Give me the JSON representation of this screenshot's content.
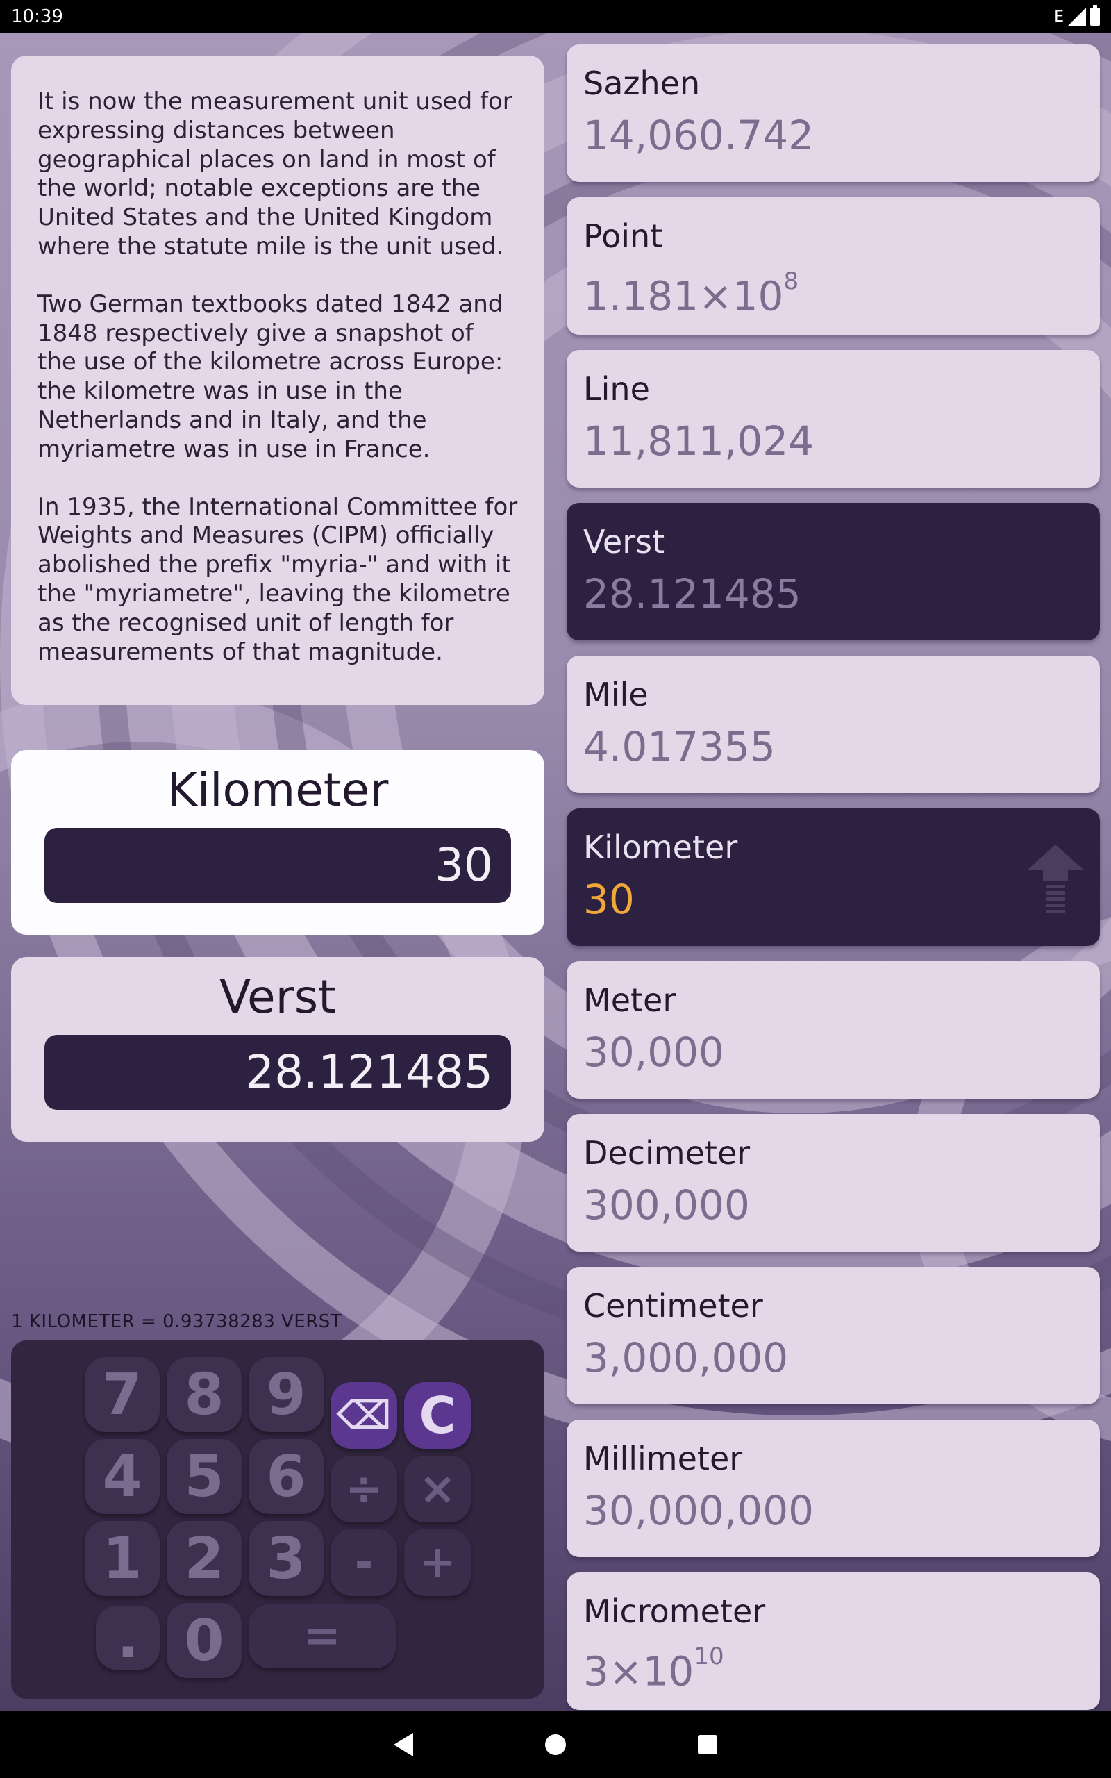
{
  "status_bar": {
    "time": "10:39",
    "network": "E"
  },
  "info": {
    "paragraphs": [
      "It is now the measurement unit used for expressing distances between geographical places on land in most of the world; notable exceptions are the United States and the United Kingdom where the statute mile is the unit used.",
      "Two German textbooks dated 1842 and 1848 respectively give a snapshot of the use of the kilometre across Europe: the kilometre was in use in the Netherlands and in Italy, and the myriametre was in use in France.",
      "In 1935, the International Committee for Weights and Measures (CIPM) officially abolished the prefix \"myria-\" and with it the \"myriametre\", leaving the kilometre as the recognised unit of length for measurements of that magnitude."
    ]
  },
  "converter": {
    "from_unit": "Kilometer",
    "from_value": "30",
    "to_unit": "Verst",
    "to_value": "28.121485",
    "ratio_text": "1 KILOMETER = 0.93738283 VERST"
  },
  "keypad": {
    "k7": "7",
    "k8": "8",
    "k9": "9",
    "k4": "4",
    "k5": "5",
    "k6": "6",
    "k1": "1",
    "k2": "2",
    "k3": "3",
    "kdot": ".",
    "k0": "0",
    "equals": "=",
    "backspace": "⌫",
    "clear": "C",
    "divide": "÷",
    "multiply": "×",
    "minus": "-",
    "plus": "+"
  },
  "units": [
    {
      "name": "Sazhen",
      "value": "14,060.742",
      "exp": ""
    },
    {
      "name": "Point",
      "value": "1.181×10",
      "exp": "8"
    },
    {
      "name": "Line",
      "value": "11,811,024",
      "exp": ""
    },
    {
      "name": "Verst",
      "value": "28.121485",
      "exp": ""
    },
    {
      "name": "Mile",
      "value": "4.017355",
      "exp": ""
    },
    {
      "name": "Kilometer",
      "value": "30",
      "exp": ""
    },
    {
      "name": "Meter",
      "value": "30,000",
      "exp": ""
    },
    {
      "name": "Decimeter",
      "value": "300,000",
      "exp": ""
    },
    {
      "name": "Centimeter",
      "value": "3,000,000",
      "exp": ""
    },
    {
      "name": "Millimeter",
      "value": "30,000,000",
      "exp": ""
    },
    {
      "name": "Micrometer",
      "value": "3×10",
      "exp": "10"
    }
  ],
  "colors": {
    "card_light": "#e3d7e8",
    "card_dark": "#2c2140",
    "active_value": "#f0a83a",
    "accent_key": "#5b3790"
  }
}
